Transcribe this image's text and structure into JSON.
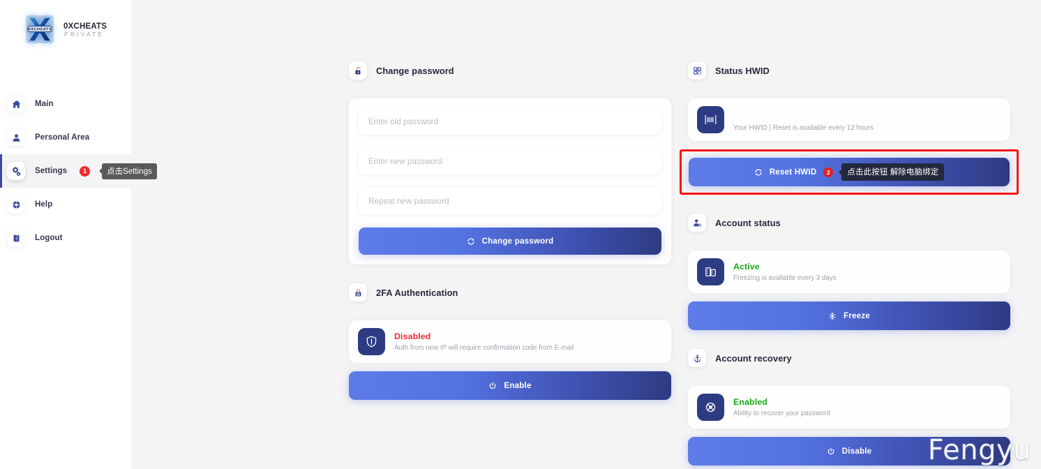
{
  "brand": {
    "title": "0XCHEATS",
    "subtitle": "PRIVATE",
    "logo_text": "0XCHEATS"
  },
  "sidebar": {
    "items": [
      {
        "label": "Main",
        "icon": "home-icon",
        "active": false
      },
      {
        "label": "Personal Area",
        "icon": "user-icon",
        "active": false
      },
      {
        "label": "Settings",
        "icon": "gears-icon",
        "active": true
      },
      {
        "label": "Help",
        "icon": "lifebuoy-icon",
        "active": false
      },
      {
        "label": "Logout",
        "icon": "logout-icon",
        "active": false
      }
    ],
    "settings_step_badge": "1",
    "settings_tooltip": "点击Settings"
  },
  "left_column": {
    "change_password": {
      "header": "Change password",
      "header_icon": "unlock-icon",
      "old_password_placeholder": "Enter old password",
      "new_password_placeholder": "Enter new password",
      "repeat_password_placeholder": "Repeat new password",
      "old_password_value": "",
      "new_password_value": "",
      "repeat_password_value": "",
      "submit_label": "Change password",
      "submit_icon": "refresh-icon"
    },
    "two_fa": {
      "header": "2FA Authentication",
      "header_icon": "lock-shield-icon",
      "status": "Disabled",
      "status_color": "#f0292f",
      "description": "Auth from new IP will require confirmation code from E-mail",
      "tile_icon": "shield-icon",
      "action_label": "Enable",
      "action_icon": "power-icon"
    }
  },
  "right_column": {
    "status_hwid": {
      "header": "Status HWID",
      "header_icon": "qr-grid-icon",
      "hwid_value": "",
      "hwid_masked": true,
      "description": "Your HWID | Reset is available every 12 hours",
      "tile_icon": "barcode-icon",
      "action_label": "Reset HWID",
      "action_icon": "refresh-icon",
      "action_step_badge": "2",
      "action_tooltip": "点击此按钮 解除电脑绑定",
      "highlight_color": "#fd0d11"
    },
    "account_status": {
      "header": "Account status",
      "header_icon": "user-gear-icon",
      "status": "Active",
      "status_color": "#15a815",
      "description": "Freezing is available every 3 days",
      "tile_icon": "building-chart-icon",
      "action_label": "Freeze",
      "action_icon": "snowflake-icon"
    },
    "account_recovery": {
      "header": "Account recovery",
      "header_icon": "anchor-icon",
      "status": "Enabled",
      "status_color": "#15a815",
      "description": "Ability to recover your password",
      "tile_icon": "lifering-icon",
      "action_label": "Disable",
      "action_icon": "power-icon"
    }
  },
  "watermark": {
    "text": "Fengyu"
  },
  "theme": {
    "page_bg": "#f4f4f5",
    "sidebar_bg": "#ffffff",
    "accent_from": "#5d7ce8",
    "accent_to": "#2e3b82",
    "text_dark": "#242938",
    "text_muted": "#9ea1ab",
    "danger": "#f0292f",
    "success": "#15a815"
  }
}
